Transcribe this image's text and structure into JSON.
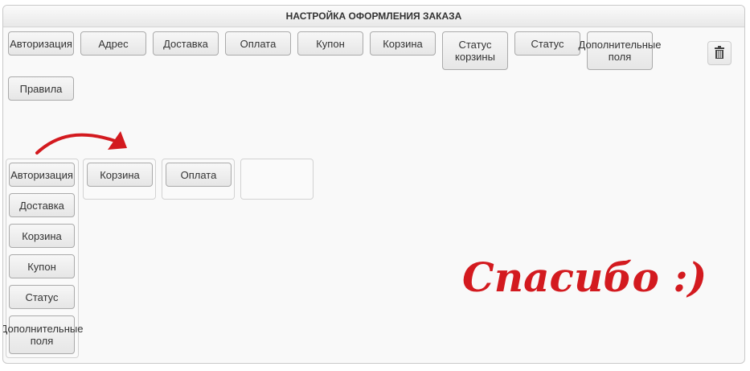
{
  "header": {
    "title": "НАСТРОЙКА ОФОРМЛЕНИЯ ЗАКАЗА"
  },
  "palette": {
    "items": [
      {
        "label": "Авторизация"
      },
      {
        "label": "Адрес"
      },
      {
        "label": "Доставка"
      },
      {
        "label": "Оплата"
      },
      {
        "label": "Купон"
      },
      {
        "label": "Корзина"
      },
      {
        "label": "Статус корзины"
      },
      {
        "label": "Статус"
      },
      {
        "label": "Дополнительные поля"
      },
      {
        "label": "Правила"
      }
    ],
    "trash_icon": "trash-icon"
  },
  "layout": {
    "column1": [
      {
        "label": "Авторизация"
      },
      {
        "label": "Доставка"
      },
      {
        "label": "Корзина"
      },
      {
        "label": "Купон"
      },
      {
        "label": "Статус"
      },
      {
        "label": "Дополнительные поля"
      }
    ],
    "column2": [
      {
        "label": "Корзина"
      }
    ],
    "column3": [
      {
        "label": "Оплата"
      }
    ],
    "column4": []
  },
  "annotation": {
    "handwritten_text": "Спасибо :)",
    "arrow_color": "#d31a1f"
  }
}
